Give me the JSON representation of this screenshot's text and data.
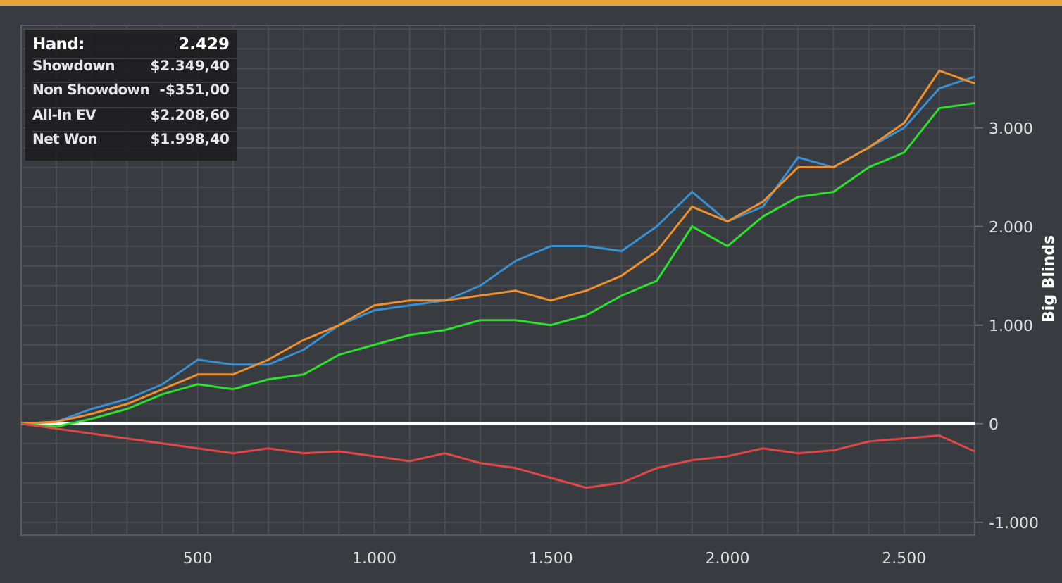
{
  "tooltip": {
    "rows": [
      {
        "label": "Hand:",
        "value": "2.429",
        "kind": "header"
      },
      {
        "label": "Showdown",
        "value": "$2.349,40",
        "kind": "row"
      },
      {
        "label": "Non Showdown",
        "value": "-$351,00",
        "kind": "row"
      },
      {
        "label": "All-In EV",
        "value": "$2.208,60",
        "kind": "row"
      },
      {
        "label": "Net Won",
        "value": "$1.998,40",
        "kind": "row"
      }
    ]
  },
  "chart_data": {
    "type": "line",
    "ylabel": "Big Blinds",
    "xlim": [
      0,
      2700
    ],
    "ylim": [
      -1130,
      4040
    ],
    "x": [
      0,
      100,
      200,
      300,
      400,
      500,
      600,
      700,
      800,
      900,
      1000,
      1100,
      1200,
      1300,
      1400,
      1500,
      1600,
      1700,
      1800,
      1900,
      2000,
      2100,
      2200,
      2300,
      2400,
      2500,
      2600,
      2700
    ],
    "series": [
      {
        "color": "#3a8fd0",
        "values": [
          0,
          20,
          150,
          250,
          400,
          650,
          600,
          600,
          750,
          1000,
          1150,
          1200,
          1250,
          1400,
          1650,
          1800,
          1800,
          1750,
          2000,
          2350,
          2050,
          2200,
          2700,
          2600,
          2800,
          3000,
          3400,
          3520
        ]
      },
      {
        "color": "#f0902a",
        "values": [
          0,
          20,
          100,
          200,
          350,
          500,
          500,
          650,
          850,
          1000,
          1200,
          1250,
          1250,
          1300,
          1350,
          1250,
          1350,
          1500,
          1750,
          2200,
          2050,
          2250,
          2600,
          2600,
          2800,
          3050,
          3580,
          3450
        ]
      },
      {
        "color": "#2ee02e",
        "values": [
          0,
          -30,
          50,
          150,
          300,
          400,
          350,
          450,
          500,
          700,
          800,
          900,
          950,
          1050,
          1050,
          1000,
          1100,
          1300,
          1450,
          2000,
          1800,
          2100,
          2300,
          2350,
          2600,
          2750,
          3200,
          3250
        ]
      },
      {
        "color": "#e04848",
        "values": [
          0,
          -50,
          -100,
          -150,
          -200,
          -250,
          -300,
          -250,
          -300,
          -280,
          -330,
          -380,
          -300,
          -400,
          -450,
          -550,
          -650,
          -600,
          -450,
          -370,
          -330,
          -250,
          -300,
          -270,
          -180,
          -150,
          -120,
          -280
        ]
      }
    ],
    "xticks": [
      {
        "value": 500,
        "label": "500"
      },
      {
        "value": 1000,
        "label": "1.000"
      },
      {
        "value": 1500,
        "label": "1.500"
      },
      {
        "value": 2000,
        "label": "2.000"
      },
      {
        "value": 2500,
        "label": "2.500"
      }
    ],
    "yticks": [
      {
        "value": -1000,
        "label": "-1.000"
      },
      {
        "value": 0,
        "label": "0"
      },
      {
        "value": 1000,
        "label": "1.000"
      },
      {
        "value": 2000,
        "label": "2.000"
      },
      {
        "value": 3000,
        "label": "3.000"
      }
    ],
    "grid": true
  }
}
